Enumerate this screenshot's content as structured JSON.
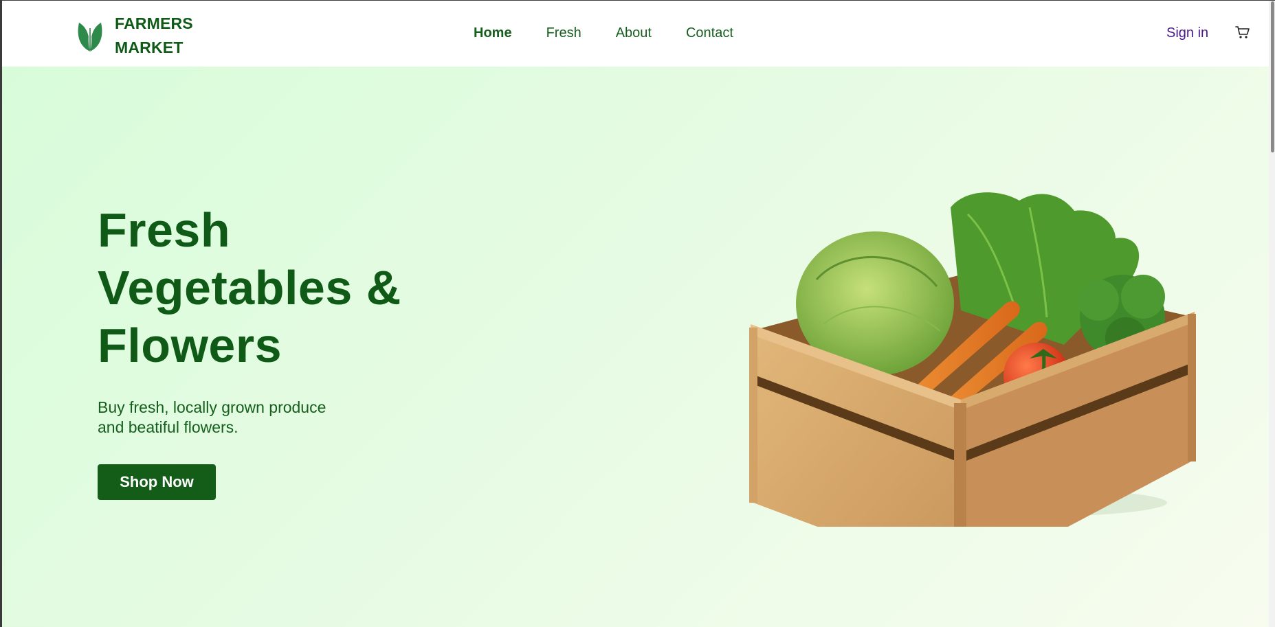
{
  "header": {
    "logo_line1": "FARMERS",
    "logo_line2": "MARKET",
    "logo_icon": "leaf-icon",
    "nav": [
      {
        "label": "Home",
        "active": true
      },
      {
        "label": "Fresh",
        "active": false
      },
      {
        "label": "About",
        "active": false
      },
      {
        "label": "Contact",
        "active": false
      }
    ],
    "signin_label": "Sign in",
    "cart_icon": "cart-icon"
  },
  "hero": {
    "title_lines": [
      "Fresh",
      "Vegetables &",
      "Flowers"
    ],
    "subtitle_lines": [
      "Buy fresh, locally grown produce",
      "and beatiful flowers."
    ],
    "cta_label": "Shop Now",
    "image_subject": "wooden crate with cabbage, lettuce, broccoli, carrots, tomatoes and peppers"
  },
  "colors": {
    "brand_green": "#135d18",
    "signin_purple": "#4b1a8a",
    "hero_bg_start": "#d8fcda",
    "hero_bg_end": "#f7fcef"
  }
}
